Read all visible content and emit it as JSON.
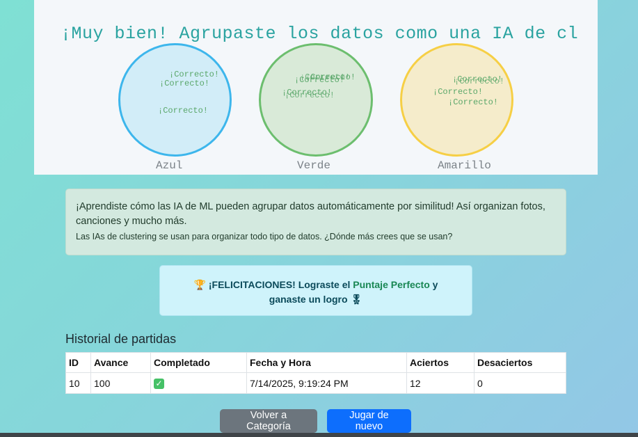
{
  "game": {
    "title": "¡Muy bien! Agrupaste los datos como una IA de cl",
    "groups": [
      {
        "name": "Azul",
        "items": [
          "¡Correcto!",
          "¡Correcto!",
          "¡Correcto!"
        ]
      },
      {
        "name": "Verde",
        "items": [
          "¡Correcto!",
          "¡Correcto!",
          "¡Correcto!",
          "¡Correcto!",
          "¡Correcto!"
        ]
      },
      {
        "name": "Amarillo",
        "items": [
          "¡Correcto!",
          "¡Correcto!",
          "¡Correcto!",
          "¡Correcto!"
        ]
      }
    ],
    "colors": {
      "azul": "#3db6ec",
      "verde": "#6cbe6e",
      "amarillo": "#f6cf45"
    }
  },
  "info": {
    "main": "¡Aprendiste cómo las IA de ML pueden agrupar datos automáticamente por similitud! Así organizan fotos, canciones y mucho más.",
    "sub": "Las IAs de clustering se usan para organizar todo tipo de datos. ¿Dónde más crees que se usan?"
  },
  "congrats": {
    "trophy_icon": "🏆",
    "part1": "¡FELICITACIONES! Lograste el ",
    "highlight": "Puntaje Perfecto",
    "part2": " y ganaste un logro ",
    "badge_icon": "🎖"
  },
  "history": {
    "title": "Historial de partidas",
    "columns": [
      "ID",
      "Avance",
      "Completado",
      "Fecha y Hora",
      "Aciertos",
      "Desaciertos"
    ],
    "rows": [
      {
        "id": "10",
        "avance": "100",
        "completado_icon": "check-box-icon",
        "fecha": "7/14/2025, 9:19:24 PM",
        "aciertos": "12",
        "desaciertos": "0"
      }
    ]
  },
  "buttons": {
    "back_label": "Volver a Categoría",
    "replay_label": "Jugar de nuevo"
  }
}
